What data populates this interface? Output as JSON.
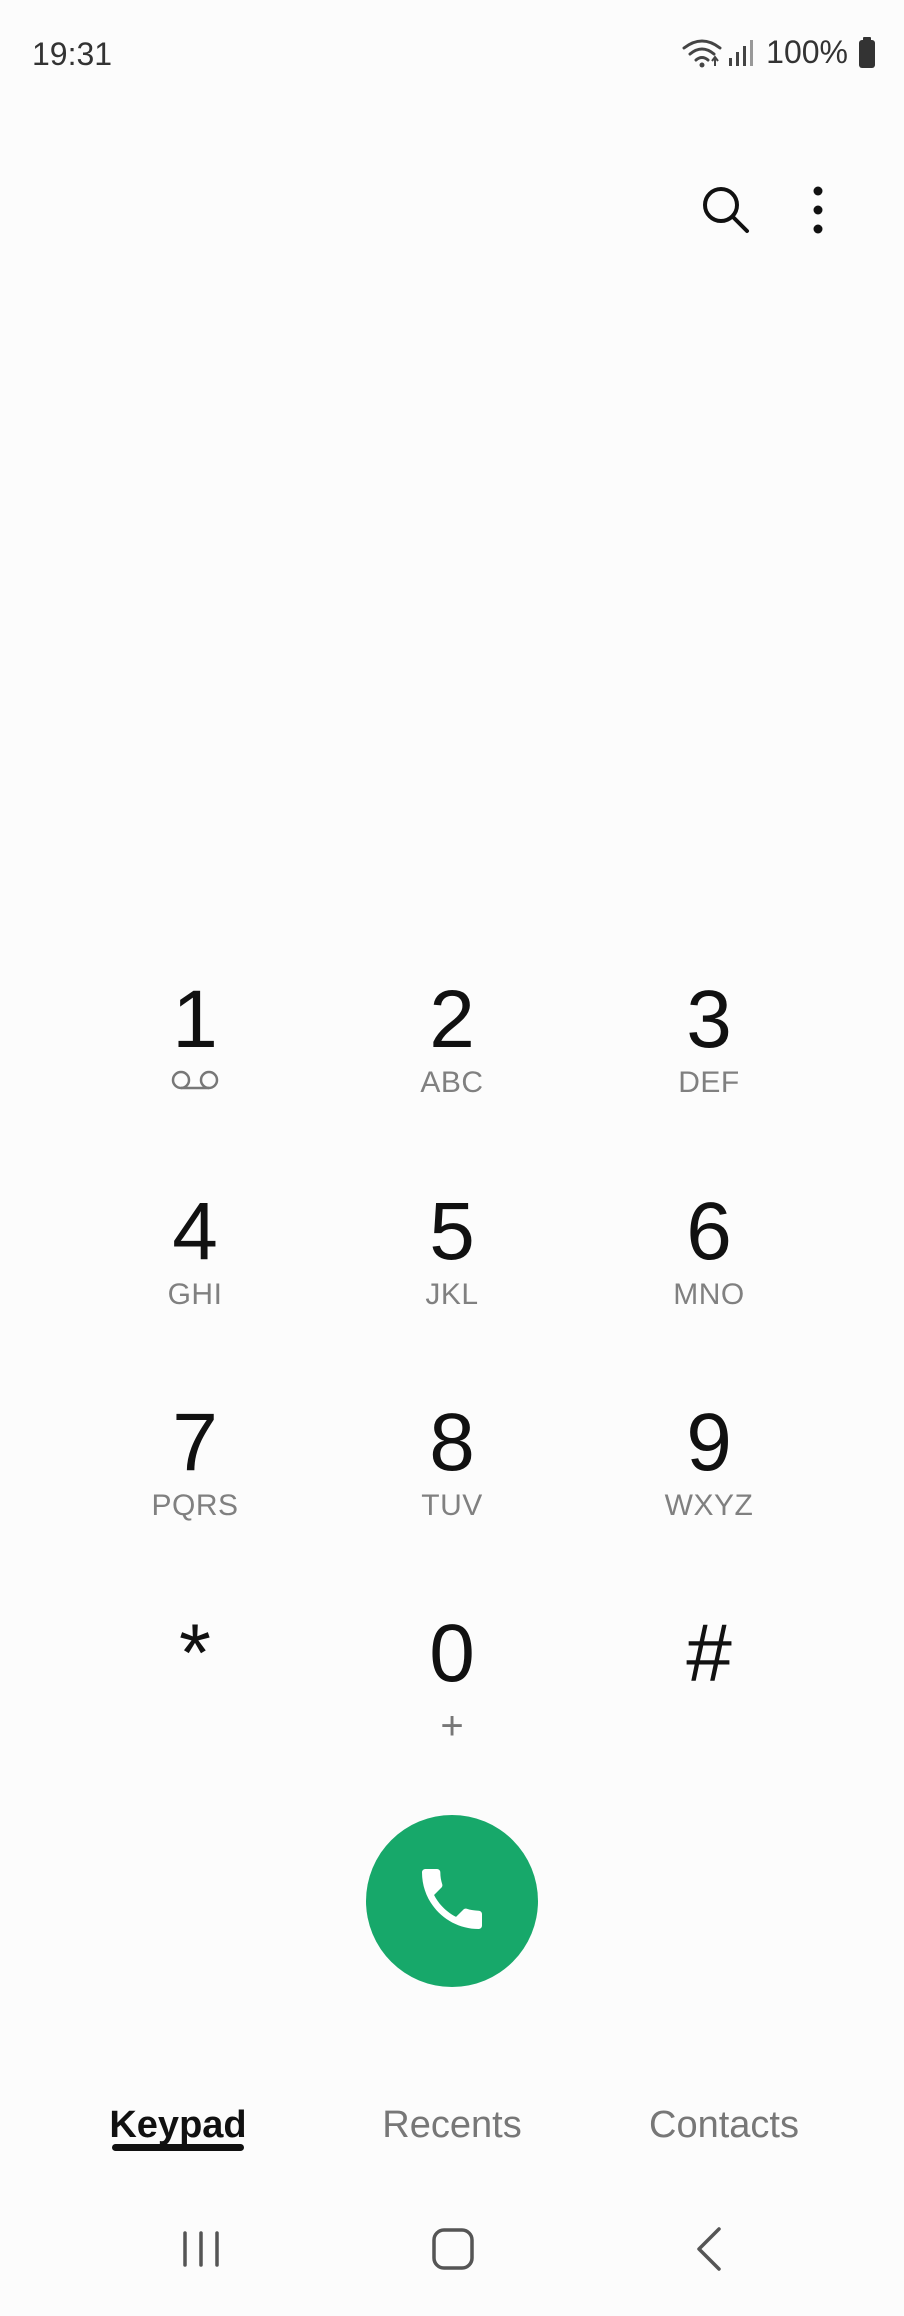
{
  "status_bar": {
    "time": "19:31",
    "battery": "100%",
    "icons": [
      "wifi-icon",
      "signal-icon",
      "battery-icon"
    ]
  },
  "top_actions": {
    "icons": [
      "search-icon",
      "more-options-icon"
    ]
  },
  "keypad": {
    "keys": [
      {
        "digit": "1",
        "letters": "",
        "sub_icon": "voicemail-icon"
      },
      {
        "digit": "2",
        "letters": "ABC"
      },
      {
        "digit": "3",
        "letters": "DEF"
      },
      {
        "digit": "4",
        "letters": "GHI"
      },
      {
        "digit": "5",
        "letters": "JKL"
      },
      {
        "digit": "6",
        "letters": "MNO"
      },
      {
        "digit": "7",
        "letters": "PQRS"
      },
      {
        "digit": "8",
        "letters": "TUV"
      },
      {
        "digit": "9",
        "letters": "WXYZ"
      },
      {
        "digit": "*",
        "letters": ""
      },
      {
        "digit": "0",
        "letters": "+"
      },
      {
        "digit": "#",
        "letters": ""
      }
    ]
  },
  "call_button": {
    "icon": "phone-icon",
    "color": "#17a86a"
  },
  "tabs": {
    "items": [
      {
        "label": "Keypad",
        "active": true
      },
      {
        "label": "Recents",
        "active": false
      },
      {
        "label": "Contacts",
        "active": false
      }
    ]
  },
  "nav_bar": {
    "icons": [
      "recent-apps-icon",
      "home-icon",
      "back-icon"
    ]
  }
}
